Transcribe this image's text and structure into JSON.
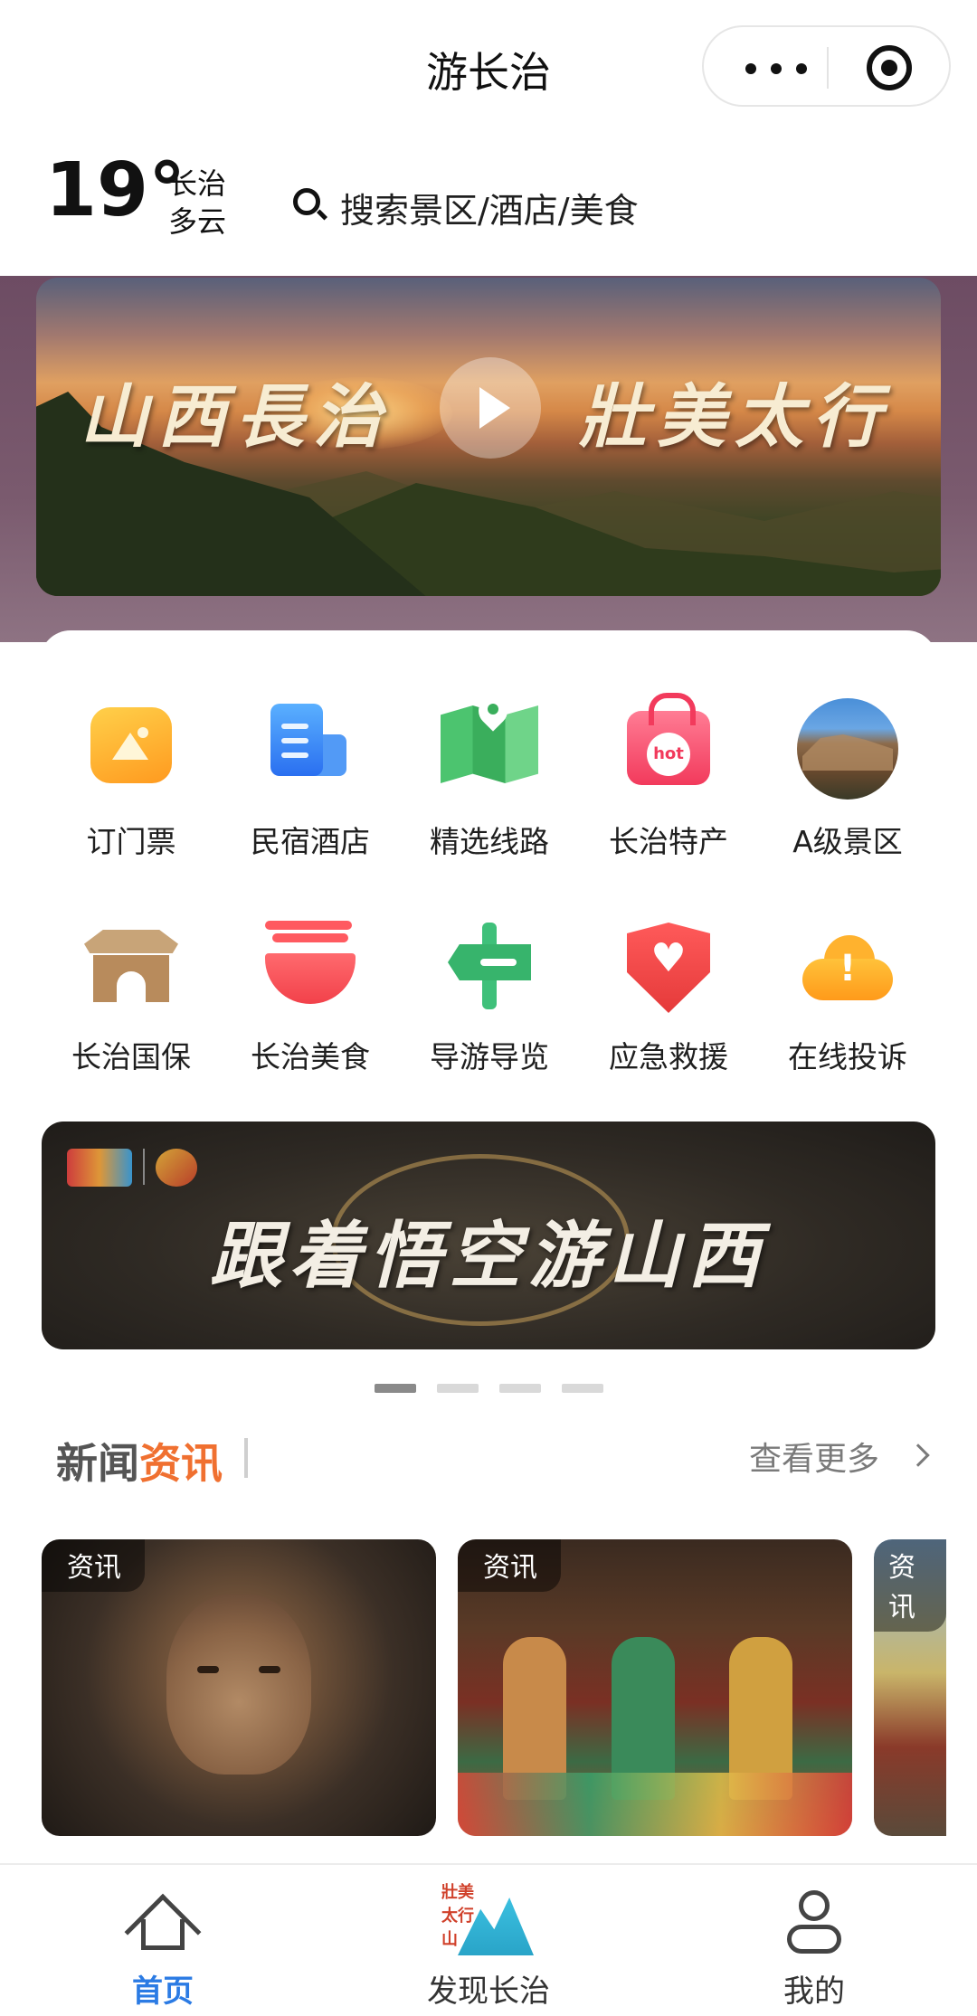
{
  "titlebar": {
    "title": "游长治"
  },
  "weather": {
    "temperature": "19°",
    "city": "长治",
    "condition": "多云"
  },
  "search": {
    "placeholder": "搜索景区/酒店/美食"
  },
  "hero": {
    "left_text": "山西長治",
    "right_text": "壯美太行"
  },
  "grid": [
    {
      "label": "订门票",
      "icon": "ticket-icon"
    },
    {
      "label": "民宿酒店",
      "icon": "hotel-icon"
    },
    {
      "label": "精选线路",
      "icon": "map-route-icon"
    },
    {
      "label": "长治特产",
      "icon": "hot-bag-icon"
    },
    {
      "label": "A级景区",
      "icon": "scenic-spot-icon"
    },
    {
      "label": "长治国保",
      "icon": "ancient-gate-icon"
    },
    {
      "label": "长治美食",
      "icon": "noodle-bowl-icon"
    },
    {
      "label": "导游导览",
      "icon": "signpost-icon"
    },
    {
      "label": "应急救援",
      "icon": "shield-heart-icon"
    },
    {
      "label": "在线投诉",
      "icon": "alert-cloud-icon"
    }
  ],
  "promo": {
    "title": "跟着悟空游山西",
    "page": 1,
    "page_count": 4
  },
  "news": {
    "title_part1": "新闻",
    "title_part2": "资讯",
    "more": "查看更多",
    "cards": [
      {
        "tag": "资讯"
      },
      {
        "tag": "资讯"
      },
      {
        "tag": "资讯"
      }
    ]
  },
  "tabbar": {
    "tabs": [
      {
        "label": "首页",
        "active": true
      },
      {
        "label": "发现长治",
        "active": false,
        "seal": "壯美太行山"
      },
      {
        "label": "我的",
        "active": false
      }
    ]
  },
  "colors": {
    "accent": "#2b7be4",
    "news_highlight": "#f07030"
  }
}
